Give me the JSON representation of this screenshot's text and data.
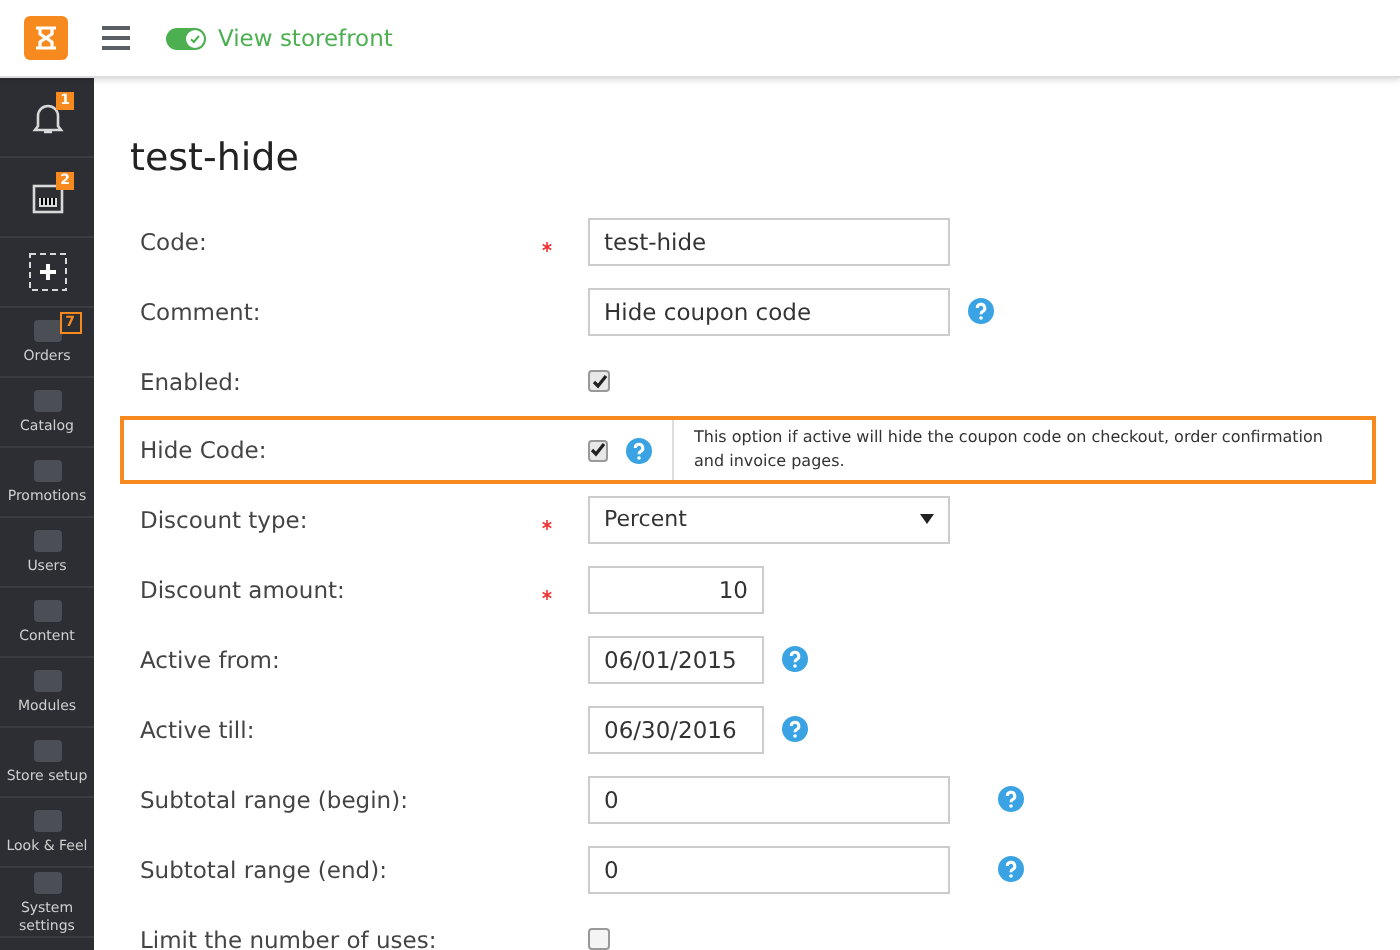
{
  "topbar": {
    "storefront_toggle": {
      "on": true,
      "label": "View storefront"
    }
  },
  "sidebar": {
    "top_items": [
      {
        "kind": "bell",
        "badge": "1"
      },
      {
        "kind": "box",
        "badge": "2"
      },
      {
        "kind": "add"
      }
    ],
    "items": [
      {
        "label": "Orders",
        "badge": "7"
      },
      {
        "label": "Catalog"
      },
      {
        "label": "Promotions"
      },
      {
        "label": "Users"
      },
      {
        "label": "Content"
      },
      {
        "label": "Modules"
      },
      {
        "label": "Store setup"
      },
      {
        "label": "Look & Feel"
      },
      {
        "label": "System settings"
      }
    ]
  },
  "page": {
    "title": "test-hide"
  },
  "form": [
    {
      "label": "Code:",
      "kind": "text",
      "required": true,
      "value": "test-hide"
    },
    {
      "label": "Comment:",
      "kind": "text",
      "required": false,
      "value": "Hide coupon code",
      "help": true
    },
    {
      "label": "Enabled:",
      "kind": "checkbox",
      "required": false,
      "checked": true
    },
    {
      "label": "Hide Code:",
      "kind": "checkbox",
      "required": false,
      "checked": true,
      "help": true,
      "highlighted": true,
      "note": "This option if active will hide the coupon code on checkout, order confirmation and invoice pages."
    },
    {
      "label": "Discount type:",
      "kind": "select",
      "required": true,
      "value": "Percent"
    },
    {
      "label": "Discount amount:",
      "kind": "number",
      "required": true,
      "value": "10"
    },
    {
      "label": "Active from:",
      "kind": "date",
      "required": false,
      "value": "06/01/2015",
      "help": true
    },
    {
      "label": "Active till:",
      "kind": "date",
      "required": false,
      "value": "06/30/2016",
      "help": true
    },
    {
      "label": "Subtotal range (begin):",
      "kind": "range",
      "required": false,
      "value": "0",
      "help": true
    },
    {
      "label": "Subtotal range (end):",
      "kind": "range",
      "required": false,
      "value": "0",
      "help": true
    },
    {
      "label": "Limit the number of uses:",
      "kind": "checkbox",
      "required": false,
      "checked": false
    }
  ]
}
